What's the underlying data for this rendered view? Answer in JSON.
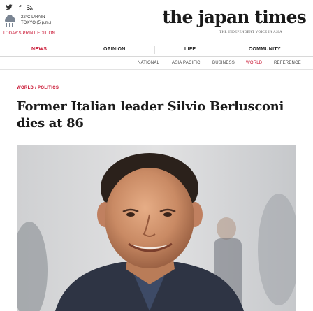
{
  "social": {
    "twitter": "🐦",
    "facebook": "f",
    "rss": "⌘"
  },
  "weather": {
    "line1": "22°C L/RAIN",
    "line2": "TOKYO (5 p.m.)"
  },
  "print_edition": "TODAY'S PRINT EDITION",
  "logo": "the japan times",
  "tagline": "THE INDEPENDENT VOICE IN ASIA",
  "main_nav": [
    "NEWS",
    "OPINION",
    "LIFE",
    "COMMUNITY"
  ],
  "sub_nav": [
    "NATIONAL",
    "ASIA PACIFIC",
    "BUSINESS",
    "WORLD",
    "REFERENCE"
  ],
  "article": {
    "kicker": "WORLD / POLITICS",
    "headline": "Former Italian leader Silvio Berlusconi dies at 86"
  },
  "colors": {
    "accent": "#c8102e",
    "text": "#1b1b1b"
  },
  "icons": {
    "twitter": "twitter-icon",
    "facebook": "facebook-icon",
    "rss": "rss-icon",
    "weather": "rain-cloud-icon"
  }
}
